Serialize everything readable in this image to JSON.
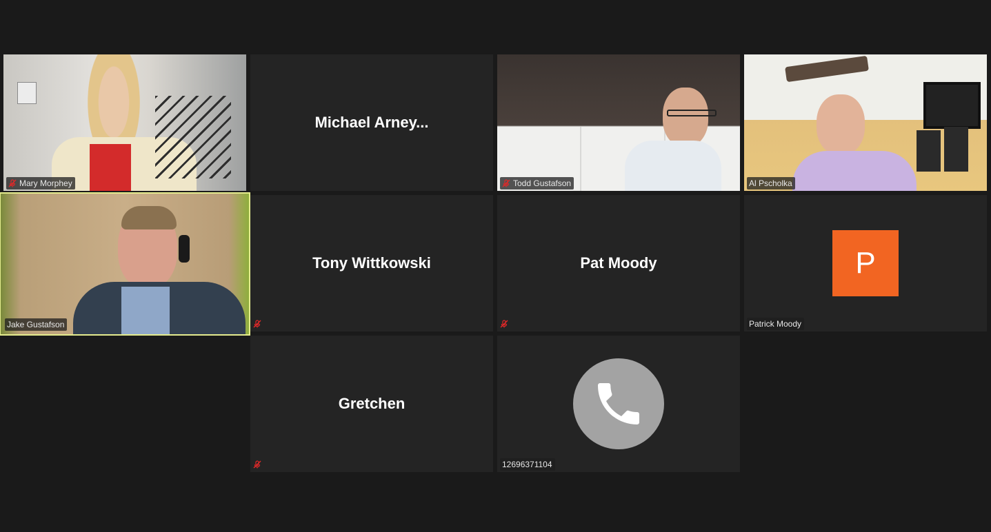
{
  "participants": [
    {
      "name": "Mary Morphey",
      "muted": true,
      "video": true
    },
    {
      "name": "Michael  Arney...",
      "muted": false,
      "video": false
    },
    {
      "name": "Todd Gustafson",
      "muted": true,
      "video": true
    },
    {
      "name": "Al Pscholka",
      "muted": false,
      "video": true
    },
    {
      "name": "Jake Gustafson",
      "muted": false,
      "video": true,
      "active_speaker": true
    },
    {
      "name": "Tony Wittkowski",
      "muted": true,
      "video": false
    },
    {
      "name": "Pat Moody",
      "muted": true,
      "video": false
    },
    {
      "name": "Patrick Moody",
      "avatar_letter": "P",
      "muted": false,
      "video": false
    },
    {
      "name": "Gretchen",
      "muted": true,
      "video": false
    },
    {
      "name": "12696371104",
      "phone": true,
      "muted": false,
      "video": false
    }
  ],
  "colors": {
    "background": "#1a1a1a",
    "tile": "#242424",
    "active_border": "#e5ec8e",
    "mute_red": "#e02828",
    "avatar_orange": "#f26522",
    "phone_circle": "#a3a3a3"
  },
  "icons": [
    "microphone-muted-icon",
    "phone-icon"
  ]
}
